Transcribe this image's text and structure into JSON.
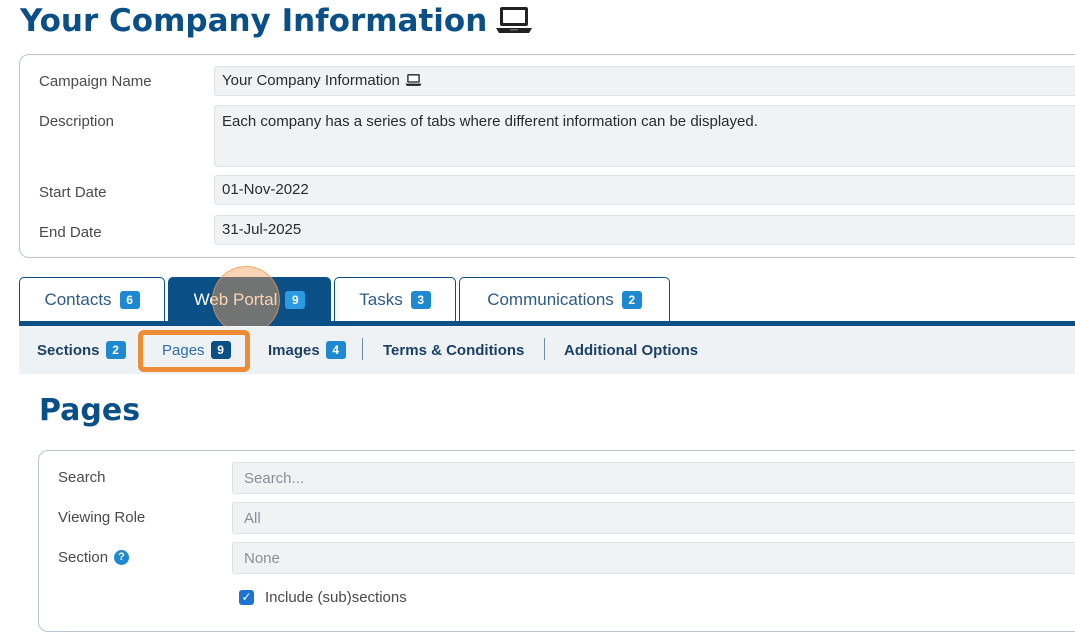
{
  "header": {
    "title": "Your Company Information",
    "icon": "laptop-icon"
  },
  "campaign": {
    "name_label": "Campaign Name",
    "name_value": "Your Company Information",
    "description_label": "Description",
    "description_value": "Each company has a series of tabs where different information can be displayed.",
    "start_label": "Start Date",
    "start_value": "01-Nov-2022",
    "end_label": "End Date",
    "end_value": "31-Jul-2025"
  },
  "tabs": [
    {
      "label": "Contacts",
      "count": "6",
      "active": false
    },
    {
      "label": "Web Portal",
      "count": "9",
      "active": true
    },
    {
      "label": "Tasks",
      "count": "3",
      "active": false
    },
    {
      "label": "Communications",
      "count": "2",
      "active": false
    }
  ],
  "subnav": [
    {
      "label": "Sections",
      "count": "2"
    },
    {
      "label": "Pages",
      "count": "9",
      "active": true
    },
    {
      "label": "Images",
      "count": "4"
    },
    {
      "label": "Terms & Conditions"
    },
    {
      "label": "Additional Options"
    }
  ],
  "pages": {
    "title": "Pages",
    "search_label": "Search",
    "search_placeholder": "Search...",
    "role_label": "Viewing Role",
    "role_value": "All",
    "section_label": "Section",
    "section_value": "None",
    "include_label": "Include (sub)sections",
    "include_checked": true
  },
  "colors": {
    "brand": "#0b4f87",
    "badge": "#1e88d0",
    "highlight": "#ee8b35"
  }
}
